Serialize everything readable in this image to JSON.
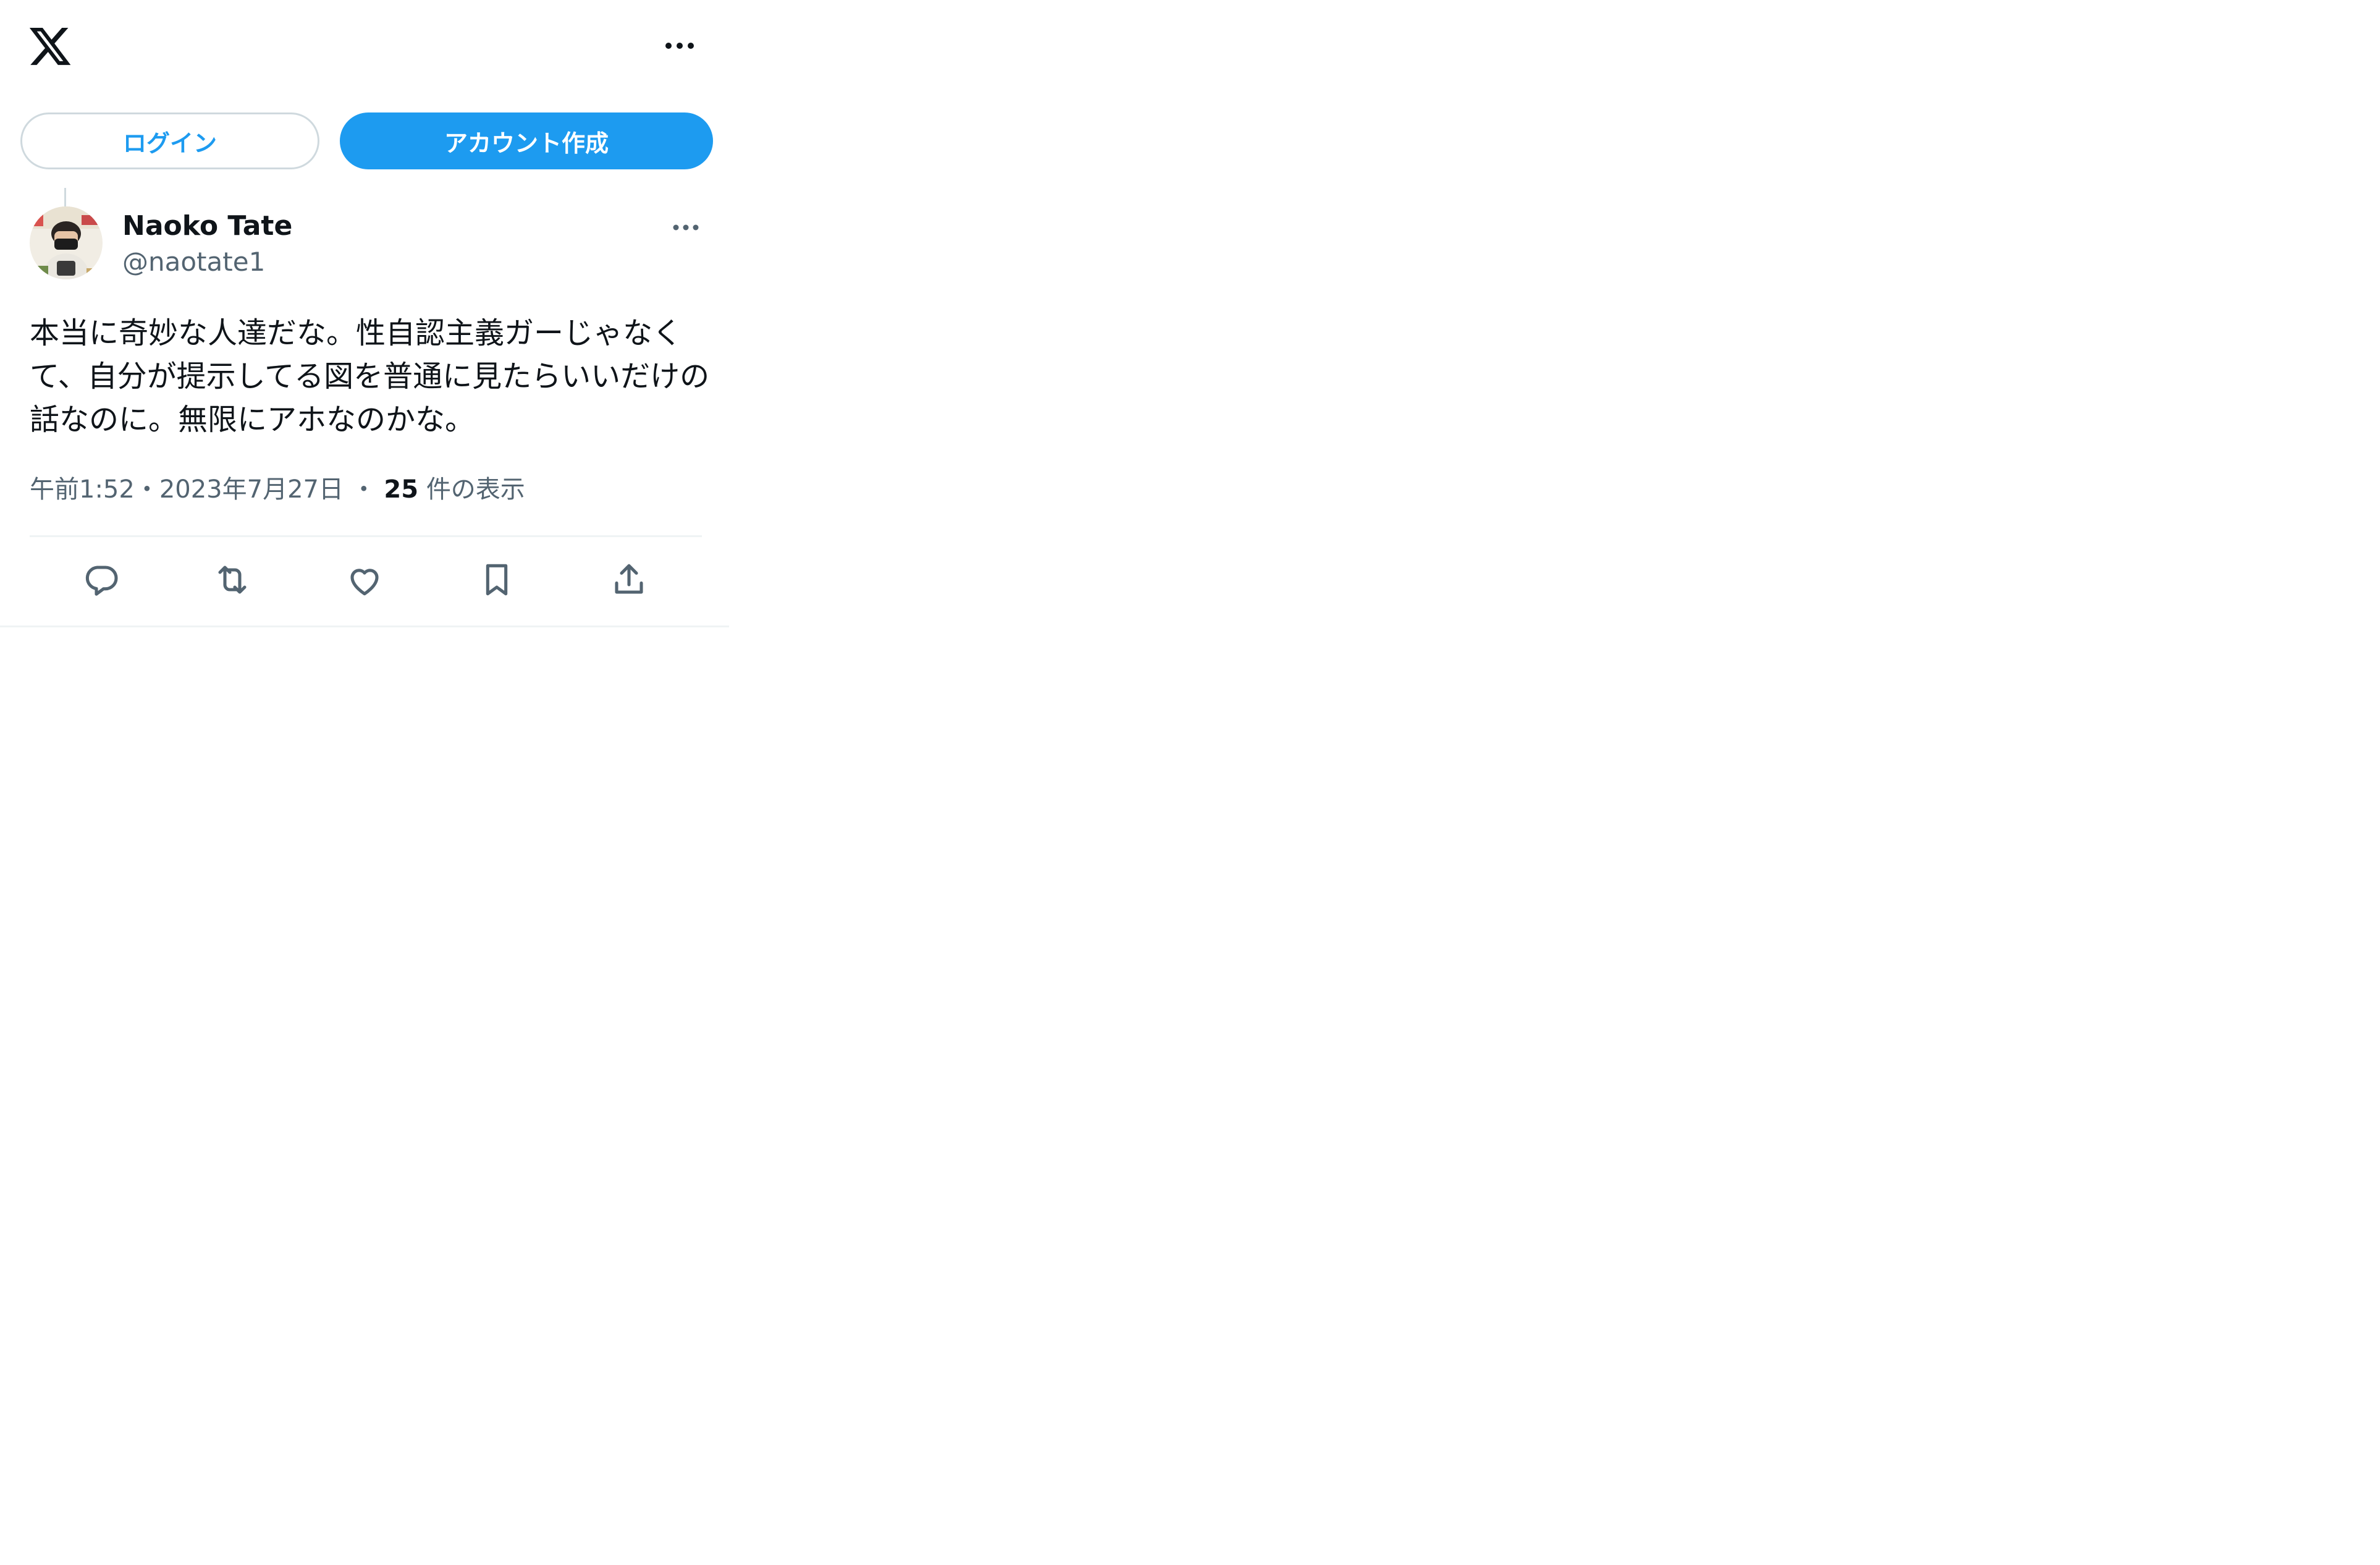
{
  "header": {
    "logo_icon": "x-logo-icon",
    "more_icon": "more-horizontal-icon"
  },
  "auth": {
    "login_label": "ログイン",
    "signup_label": "アカウント作成",
    "accent_color": "#1d9bf0"
  },
  "tweet": {
    "author": {
      "display_name": "Naoko Tate",
      "handle": "@naotate1"
    },
    "text": "本当に奇妙な人達だな。性自認主義ガーじゃなくて、自分が提示してる図を普通に見たらいいだけの話なのに。無限にアホなのかな。",
    "time": "午前1:52",
    "separator": "・",
    "date": "2023年7月27日",
    "views_count": "25",
    "views_label": "件の表示",
    "actions": [
      {
        "icon": "reply-icon"
      },
      {
        "icon": "retweet-icon"
      },
      {
        "icon": "like-icon"
      },
      {
        "icon": "bookmark-icon"
      },
      {
        "icon": "share-icon"
      }
    ]
  }
}
